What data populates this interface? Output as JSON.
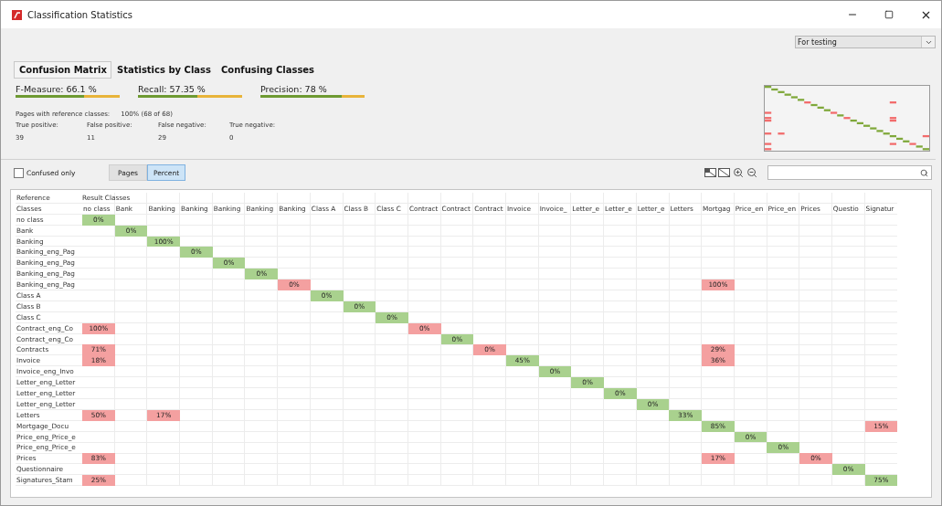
{
  "window": {
    "title": "Classification Statistics"
  },
  "dataset_select": {
    "value": "For testing"
  },
  "tabs": [
    {
      "label": "Confusion Matrix",
      "selected": true
    },
    {
      "label": "Statistics by Class",
      "selected": false
    },
    {
      "label": "Confusing Classes",
      "selected": false
    }
  ],
  "metrics": [
    {
      "label": "F-Measure: 66.1 %",
      "level": 0.661
    },
    {
      "label": "Recall: 57.35 %",
      "level": 0.5735
    },
    {
      "label": "Precision: 78 %",
      "level": 0.78
    }
  ],
  "summary": {
    "label": "Pages with reference classes:",
    "value": "100% (68 of 68)"
  },
  "counts": [
    {
      "label": "True positive:",
      "value": "39"
    },
    {
      "label": "False positive:",
      "value": "11"
    },
    {
      "label": "False negative:",
      "value": "29"
    },
    {
      "label": "True negative:",
      "value": "0"
    }
  ],
  "confused_only": {
    "label": "Confused only",
    "checked": false
  },
  "view_buttons": [
    {
      "label": "Pages",
      "selected": false
    },
    {
      "label": "Percent",
      "selected": true
    }
  ],
  "matrix": {
    "corner": [
      "Reference",
      "Classes"
    ],
    "result_header": "Result Classes",
    "columns": [
      "no class",
      "Bank",
      "Banking",
      "Banking",
      "Banking",
      "Banking",
      "Banking",
      "Class A",
      "Class B",
      "Class C",
      "Contract",
      "Contract",
      "Contract",
      "Invoice",
      "Invoice_",
      "Letter_e",
      "Letter_e",
      "Letter_e",
      "Letters",
      "Mortgag",
      "Price_en",
      "Price_en",
      "Prices",
      "Questio",
      "Signatur"
    ],
    "rows": [
      {
        "label": "no class",
        "cells": [
          {
            "text": "0%",
            "kind": "hit"
          },
          null,
          null,
          null,
          null,
          null,
          null,
          null,
          null,
          null,
          null,
          null,
          null,
          null,
          null,
          null,
          null,
          null,
          null,
          null,
          null,
          null,
          null,
          null,
          null
        ]
      },
      {
        "label": "Bank",
        "cells": [
          null,
          {
            "text": "0%",
            "kind": "hit"
          },
          null,
          null,
          null,
          null,
          null,
          null,
          null,
          null,
          null,
          null,
          null,
          null,
          null,
          null,
          null,
          null,
          null,
          null,
          null,
          null,
          null,
          null,
          null
        ]
      },
      {
        "label": "Banking",
        "cells": [
          null,
          null,
          {
            "text": "100%",
            "kind": "hit"
          },
          null,
          null,
          null,
          null,
          null,
          null,
          null,
          null,
          null,
          null,
          null,
          null,
          null,
          null,
          null,
          null,
          null,
          null,
          null,
          null,
          null,
          null
        ]
      },
      {
        "label": "Banking_eng_Pag",
        "cells": [
          null,
          null,
          null,
          {
            "text": "0%",
            "kind": "hit"
          },
          null,
          null,
          null,
          null,
          null,
          null,
          null,
          null,
          null,
          null,
          null,
          null,
          null,
          null,
          null,
          null,
          null,
          null,
          null,
          null,
          null
        ]
      },
      {
        "label": "Banking_eng_Pag",
        "cells": [
          null,
          null,
          null,
          null,
          {
            "text": "0%",
            "kind": "hit"
          },
          null,
          null,
          null,
          null,
          null,
          null,
          null,
          null,
          null,
          null,
          null,
          null,
          null,
          null,
          null,
          null,
          null,
          null,
          null,
          null
        ]
      },
      {
        "label": "Banking_eng_Pag",
        "cells": [
          null,
          null,
          null,
          null,
          null,
          {
            "text": "0%",
            "kind": "hit"
          },
          null,
          null,
          null,
          null,
          null,
          null,
          null,
          null,
          null,
          null,
          null,
          null,
          null,
          null,
          null,
          null,
          null,
          null,
          null
        ]
      },
      {
        "label": "Banking_eng_Pag",
        "cells": [
          null,
          null,
          null,
          null,
          null,
          null,
          {
            "text": "0%",
            "kind": "miss"
          },
          null,
          null,
          null,
          null,
          null,
          null,
          null,
          null,
          null,
          null,
          null,
          null,
          {
            "text": "100%",
            "kind": "miss"
          },
          null,
          null,
          null,
          null,
          null
        ]
      },
      {
        "label": "Class A",
        "cells": [
          null,
          null,
          null,
          null,
          null,
          null,
          null,
          {
            "text": "0%",
            "kind": "hit"
          },
          null,
          null,
          null,
          null,
          null,
          null,
          null,
          null,
          null,
          null,
          null,
          null,
          null,
          null,
          null,
          null,
          null
        ]
      },
      {
        "label": "Class B",
        "cells": [
          null,
          null,
          null,
          null,
          null,
          null,
          null,
          null,
          {
            "text": "0%",
            "kind": "hit"
          },
          null,
          null,
          null,
          null,
          null,
          null,
          null,
          null,
          null,
          null,
          null,
          null,
          null,
          null,
          null,
          null
        ]
      },
      {
        "label": "Class C",
        "cells": [
          null,
          null,
          null,
          null,
          null,
          null,
          null,
          null,
          null,
          {
            "text": "0%",
            "kind": "hit"
          },
          null,
          null,
          null,
          null,
          null,
          null,
          null,
          null,
          null,
          null,
          null,
          null,
          null,
          null,
          null
        ]
      },
      {
        "label": "Contract_eng_Co",
        "cells": [
          {
            "text": "100%",
            "kind": "miss"
          },
          null,
          null,
          null,
          null,
          null,
          null,
          null,
          null,
          null,
          {
            "text": "0%",
            "kind": "miss"
          },
          null,
          null,
          null,
          null,
          null,
          null,
          null,
          null,
          null,
          null,
          null,
          null,
          null,
          null
        ]
      },
      {
        "label": "Contract_eng_Co",
        "cells": [
          null,
          null,
          null,
          null,
          null,
          null,
          null,
          null,
          null,
          null,
          null,
          {
            "text": "0%",
            "kind": "hit"
          },
          null,
          null,
          null,
          null,
          null,
          null,
          null,
          null,
          null,
          null,
          null,
          null,
          null
        ]
      },
      {
        "label": "Contracts",
        "cells": [
          {
            "text": "71%",
            "kind": "miss"
          },
          null,
          null,
          null,
          null,
          null,
          null,
          null,
          null,
          null,
          null,
          null,
          {
            "text": "0%",
            "kind": "miss"
          },
          null,
          null,
          null,
          null,
          null,
          null,
          {
            "text": "29%",
            "kind": "miss"
          },
          null,
          null,
          null,
          null,
          null
        ]
      },
      {
        "label": "Invoice",
        "cells": [
          {
            "text": "18%",
            "kind": "miss"
          },
          null,
          null,
          null,
          null,
          null,
          null,
          null,
          null,
          null,
          null,
          null,
          null,
          {
            "text": "45%",
            "kind": "hit"
          },
          null,
          null,
          null,
          null,
          null,
          {
            "text": "36%",
            "kind": "miss"
          },
          null,
          null,
          null,
          null,
          null
        ]
      },
      {
        "label": "Invoice_eng_Invo",
        "cells": [
          null,
          null,
          null,
          null,
          null,
          null,
          null,
          null,
          null,
          null,
          null,
          null,
          null,
          null,
          {
            "text": "0%",
            "kind": "hit"
          },
          null,
          null,
          null,
          null,
          null,
          null,
          null,
          null,
          null,
          null
        ]
      },
      {
        "label": "Letter_eng_Letter",
        "cells": [
          null,
          null,
          null,
          null,
          null,
          null,
          null,
          null,
          null,
          null,
          null,
          null,
          null,
          null,
          null,
          {
            "text": "0%",
            "kind": "hit"
          },
          null,
          null,
          null,
          null,
          null,
          null,
          null,
          null,
          null
        ]
      },
      {
        "label": "Letter_eng_Letter",
        "cells": [
          null,
          null,
          null,
          null,
          null,
          null,
          null,
          null,
          null,
          null,
          null,
          null,
          null,
          null,
          null,
          null,
          {
            "text": "0%",
            "kind": "hit"
          },
          null,
          null,
          null,
          null,
          null,
          null,
          null,
          null
        ]
      },
      {
        "label": "Letter_eng_Letter",
        "cells": [
          null,
          null,
          null,
          null,
          null,
          null,
          null,
          null,
          null,
          null,
          null,
          null,
          null,
          null,
          null,
          null,
          null,
          {
            "text": "0%",
            "kind": "hit"
          },
          null,
          null,
          null,
          null,
          null,
          null,
          null
        ]
      },
      {
        "label": "Letters",
        "cells": [
          {
            "text": "50%",
            "kind": "miss"
          },
          null,
          {
            "text": "17%",
            "kind": "miss"
          },
          null,
          null,
          null,
          null,
          null,
          null,
          null,
          null,
          null,
          null,
          null,
          null,
          null,
          null,
          null,
          {
            "text": "33%",
            "kind": "hit"
          },
          null,
          null,
          null,
          null,
          null,
          null
        ]
      },
      {
        "label": "Mortgage_Docu",
        "cells": [
          null,
          null,
          null,
          null,
          null,
          null,
          null,
          null,
          null,
          null,
          null,
          null,
          null,
          null,
          null,
          null,
          null,
          null,
          null,
          {
            "text": "85%",
            "kind": "hit"
          },
          null,
          null,
          null,
          null,
          {
            "text": "15%",
            "kind": "miss"
          }
        ]
      },
      {
        "label": "Price_eng_Price_e",
        "cells": [
          null,
          null,
          null,
          null,
          null,
          null,
          null,
          null,
          null,
          null,
          null,
          null,
          null,
          null,
          null,
          null,
          null,
          null,
          null,
          null,
          {
            "text": "0%",
            "kind": "hit"
          },
          null,
          null,
          null,
          null
        ]
      },
      {
        "label": "Price_eng_Price_e",
        "cells": [
          null,
          null,
          null,
          null,
          null,
          null,
          null,
          null,
          null,
          null,
          null,
          null,
          null,
          null,
          null,
          null,
          null,
          null,
          null,
          null,
          null,
          {
            "text": "0%",
            "kind": "hit"
          },
          null,
          null,
          null
        ]
      },
      {
        "label": "Prices",
        "cells": [
          {
            "text": "83%",
            "kind": "miss"
          },
          null,
          null,
          null,
          null,
          null,
          null,
          null,
          null,
          null,
          null,
          null,
          null,
          null,
          null,
          null,
          null,
          null,
          null,
          {
            "text": "17%",
            "kind": "miss"
          },
          null,
          null,
          {
            "text": "0%",
            "kind": "miss"
          },
          null,
          null
        ]
      },
      {
        "label": "Questionnaire",
        "cells": [
          null,
          null,
          null,
          null,
          null,
          null,
          null,
          null,
          null,
          null,
          null,
          null,
          null,
          null,
          null,
          null,
          null,
          null,
          null,
          null,
          null,
          null,
          null,
          {
            "text": "0%",
            "kind": "hit"
          },
          null
        ]
      },
      {
        "label": "Signatures_Stam",
        "cells": [
          {
            "text": "25%",
            "kind": "miss"
          },
          null,
          null,
          null,
          null,
          null,
          null,
          null,
          null,
          null,
          null,
          null,
          null,
          null,
          null,
          null,
          null,
          null,
          null,
          null,
          null,
          null,
          null,
          null,
          {
            "text": "75%",
            "kind": "hit"
          }
        ]
      }
    ]
  }
}
